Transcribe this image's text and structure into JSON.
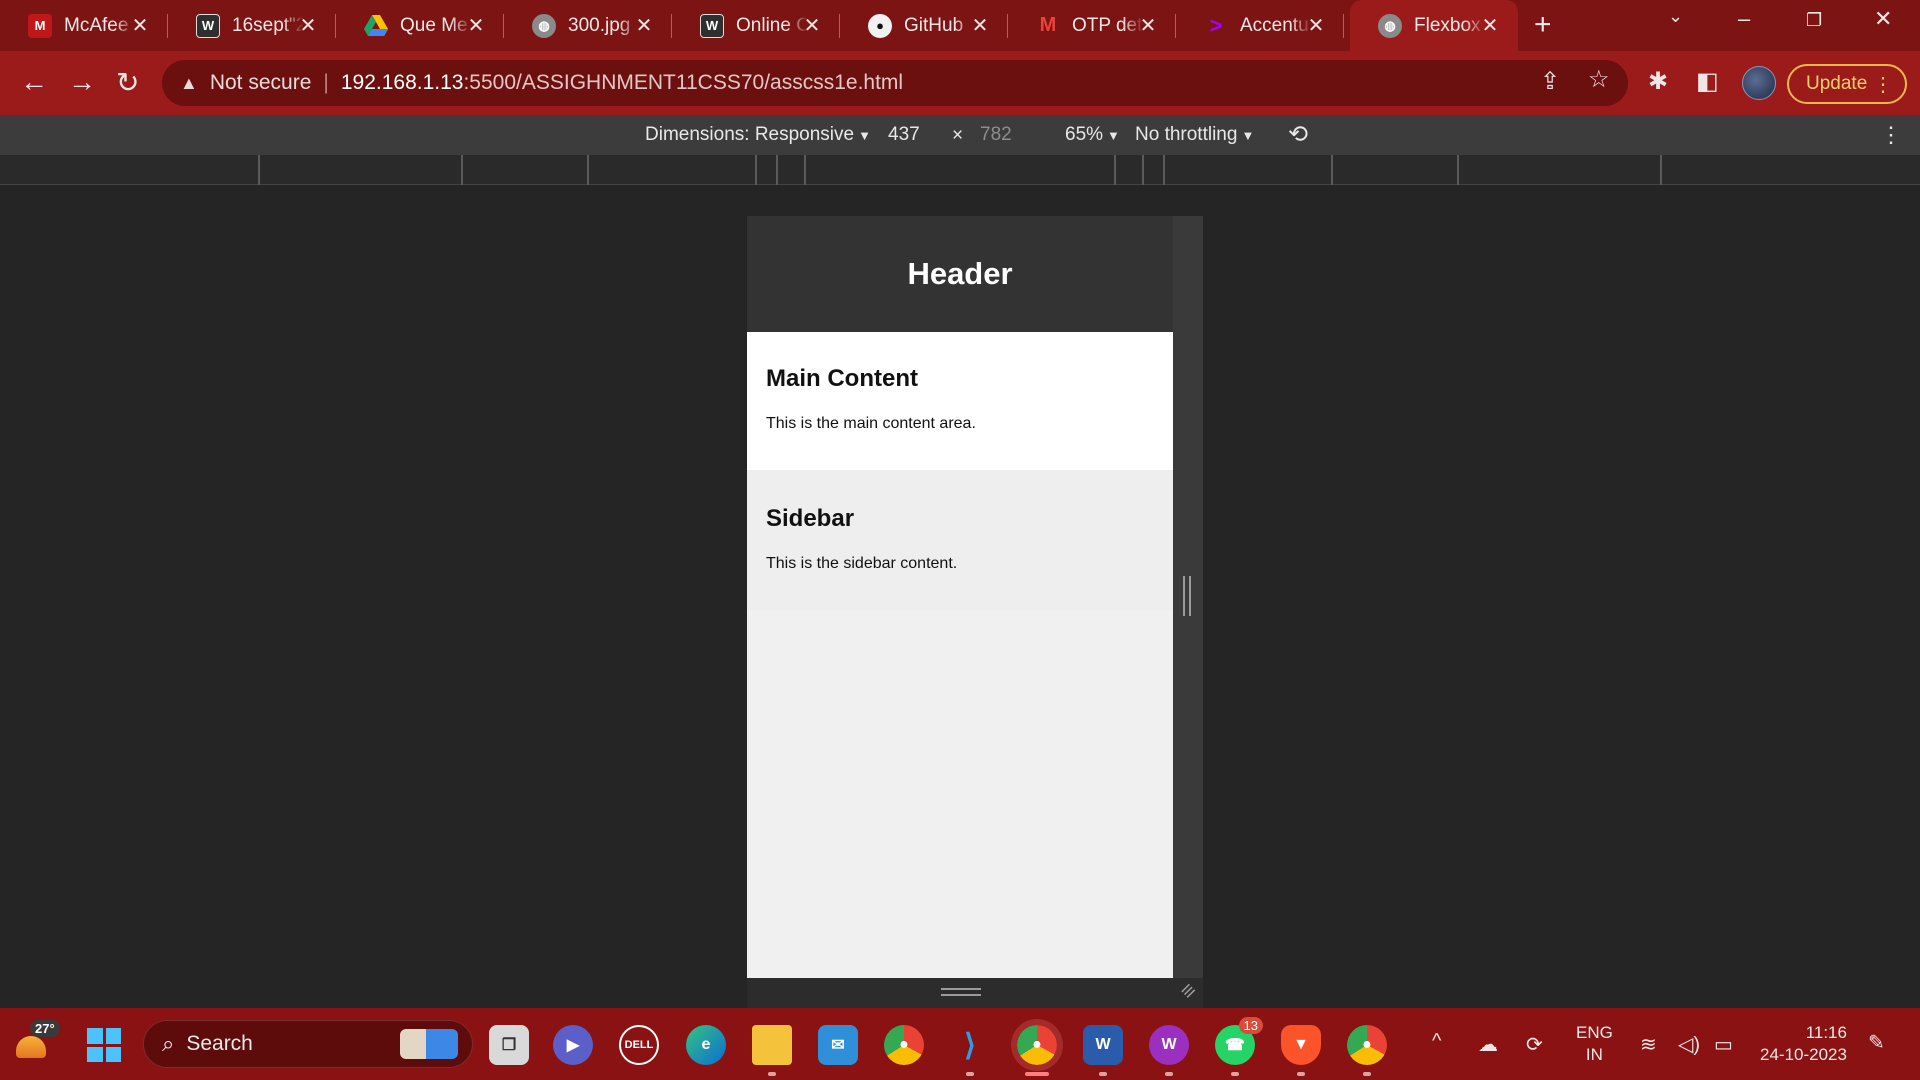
{
  "browser": {
    "tabs": [
      {
        "label": "McAfee",
        "icon": "mcafee-icon",
        "color": "#c01818"
      },
      {
        "label": "16sept\"2",
        "icon": "wordpress-icon",
        "color": "#2f2f2f"
      },
      {
        "label": "Que Me",
        "icon": "google-drive-icon",
        "color": "#1fa463"
      },
      {
        "label": "300.jpg",
        "icon": "globe-icon",
        "color": "#8a8a8a"
      },
      {
        "label": "Online C",
        "icon": "wordpress-icon",
        "color": "#2f2f2f"
      },
      {
        "label": "GitHub",
        "icon": "github-icon",
        "color": "#111111"
      },
      {
        "label": "OTP det",
        "icon": "gmail-icon",
        "color": "#ea4335"
      },
      {
        "label": "Accentu",
        "icon": "accenture-icon",
        "color": "#a100ff"
      },
      {
        "label": "Flexbox",
        "icon": "globe-icon",
        "color": "#8a8a8a",
        "active": true
      }
    ],
    "address": {
      "security": "Not secure",
      "host": "192.168.1.13",
      "path": ":5500/ASSIGHNMENT11CSS70/asscss1e.html"
    },
    "update_label": "Update"
  },
  "devtools": {
    "dimensions_label": "Dimensions: Responsive",
    "width": "437",
    "height": "782",
    "times": "×",
    "zoom": "65%",
    "throttling": "No throttling"
  },
  "page": {
    "header": "Header",
    "main": {
      "title": "Main Content",
      "text": "This is the main content area."
    },
    "sidebar": {
      "title": "Sidebar",
      "text": "This is the sidebar content."
    }
  },
  "taskbar": {
    "weather_temp": "27°",
    "search_placeholder": "Search",
    "whatsapp_badge": "13",
    "lang_top": "ENG",
    "lang_bottom": "IN",
    "time": "11:16",
    "date": "24-10-2023"
  },
  "colors": {
    "tabstrip": "#7c1414",
    "toolbar": "#9b1b1b",
    "taskbar": "#8a1212",
    "page_header": "#333333",
    "accent_update": "#e7b84a"
  }
}
